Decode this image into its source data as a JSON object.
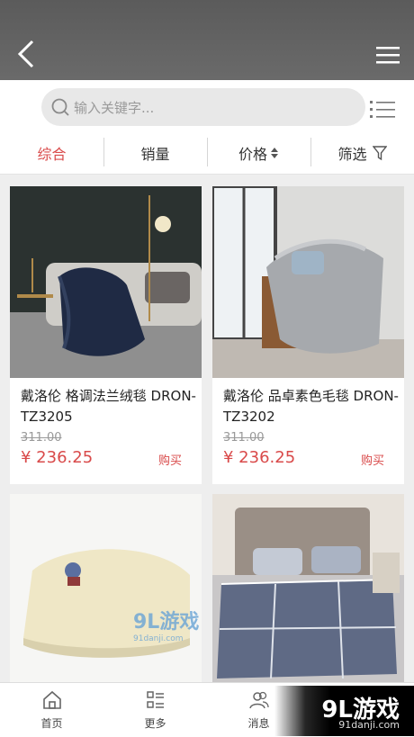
{
  "header": {
    "back_icon": "back-chevron-icon",
    "menu_icon": "hamburger-menu-icon",
    "bg": "#5f5f5f"
  },
  "search": {
    "placeholder": "输入关键字...",
    "icon": "search-icon",
    "view_toggle_icon": "list-view-icon"
  },
  "tabs": [
    {
      "label": "综合",
      "active": true
    },
    {
      "label": "销量"
    },
    {
      "label": "价格",
      "icon": "sort-arrows-icon"
    },
    {
      "label": "筛选",
      "icon": "filter-icon"
    }
  ],
  "products": [
    {
      "title": "戴洛伦 格调法兰绒毯 DRON-TZ3205",
      "old_price": "311.00",
      "price": "¥ 236.25",
      "buy": "购买"
    },
    {
      "title": "戴洛伦 品卓素色毛毯 DRON-TZ3202",
      "old_price": "311.00",
      "price": "¥ 236.25",
      "buy": "购买"
    },
    {
      "title": "",
      "old_price": "",
      "price": "",
      "buy": ""
    },
    {
      "title": "",
      "old_price": "",
      "price": "",
      "buy": ""
    }
  ],
  "bottom_nav": [
    {
      "label": "首页",
      "icon": "home-icon"
    },
    {
      "label": "更多",
      "icon": "more-grid-icon"
    },
    {
      "label": "消息",
      "icon": "users-icon"
    },
    {
      "label": "",
      "icon": ""
    }
  ],
  "watermarks": {
    "center_text": "9L游戏",
    "center_sub": "91danji.com",
    "corner_text": "9L游戏",
    "corner_sub": "91danji.com"
  },
  "colors": {
    "accent": "#d94a4a",
    "background": "#eeeeee"
  }
}
